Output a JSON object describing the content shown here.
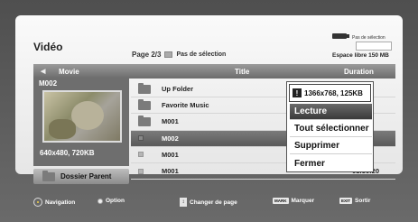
{
  "header": {
    "title": "Vidéo",
    "page": "Page 2/3",
    "selection_status": "Pas de sélection",
    "selection_label": "Pas de sélection",
    "free_space": "Espace libre 150 MB"
  },
  "table": {
    "col_movie": "Movie",
    "col_title": "Title",
    "col_duration": "Duration",
    "rows": [
      {
        "type": "folder",
        "name": "Up Folder",
        "duration": ""
      },
      {
        "type": "folder",
        "name": "Favorite Music",
        "duration": ""
      },
      {
        "type": "file",
        "name": "M001",
        "duration": ""
      },
      {
        "type": "file",
        "name": "M002",
        "duration": ""
      },
      {
        "type": "file",
        "name": "M001",
        "duration": ""
      },
      {
        "type": "file",
        "name": "M001",
        "duration": "01:30:20"
      }
    ]
  },
  "preview": {
    "name": "M002",
    "resolution": "640x480, 720KB"
  },
  "dossier_parent": "Dossier Parent",
  "context_menu": {
    "info": "1366x768, 125KB",
    "items": [
      "Lecture",
      "Tout sélectionner",
      "Supprimer",
      "Fermer"
    ],
    "active_index": 0
  },
  "footer": {
    "navigation": "Navigation",
    "option": "Option",
    "change_page": "Changer de page",
    "mark_key": "MARK",
    "mark": "Marquer",
    "exit_key": "EXIT",
    "exit": "Sortir"
  },
  "colors": {
    "selected_row": "#6a6a6a",
    "panel_bg": "#f2f2f2",
    "frame_bg": "#5a5a5a"
  }
}
